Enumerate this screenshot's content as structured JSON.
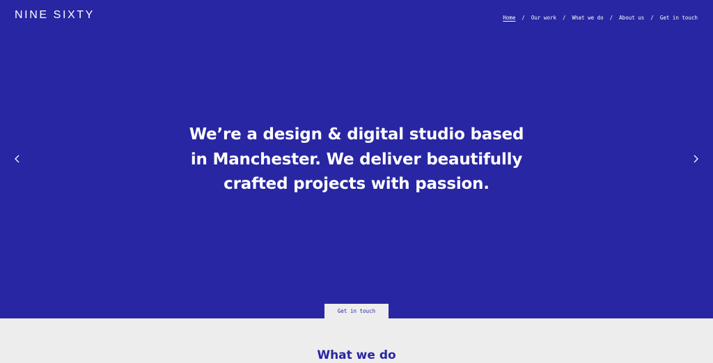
{
  "brand": {
    "logo": "NINE SIXTY"
  },
  "nav": {
    "items": [
      "Home",
      "Our work",
      "What we do",
      "About us",
      "Get in touch"
    ],
    "separator": "/",
    "active": "Home"
  },
  "hero": {
    "line1": "We’re a design & digital studio based",
    "line2": "in Manchester. We deliver beautifully",
    "line3": "crafted projects with passion.",
    "prev_icon": "chevron-left-icon",
    "next_icon": "chevron-right-icon",
    "cta_label": "Get in touch"
  },
  "section": {
    "title": "What we do"
  },
  "colors": {
    "brand_blue": "#2826a2",
    "light_grey": "#ededed",
    "white": "#ffffff"
  }
}
